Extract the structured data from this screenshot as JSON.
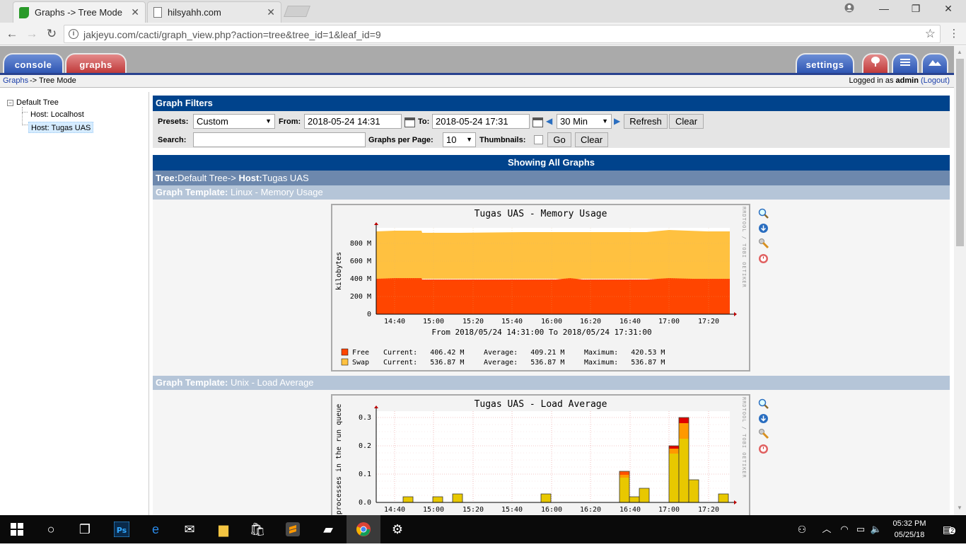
{
  "browser": {
    "tabs": [
      {
        "title": "Graphs -> Tree Mode",
        "active": true,
        "favicon": "cacti-icon"
      },
      {
        "title": "hilsyahh.com",
        "active": false,
        "favicon": "page-icon"
      }
    ],
    "close_glyph": "✕",
    "url": "jakjeyu.com/cacti/graph_view.php?action=tree&tree_id=1&leaf_id=9"
  },
  "cacti": {
    "tabs": {
      "console": "console",
      "graphs": "graphs",
      "settings": "settings"
    },
    "breadcrumb": {
      "root": "Graphs",
      "separator": "->",
      "current": "Tree Mode"
    },
    "login": {
      "prefix": "Logged in as",
      "user": "admin",
      "logout": "(Logout)"
    }
  },
  "tree": {
    "root": "Default Tree",
    "nodes": [
      "Host: Localhost",
      "Host: Tugas UAS"
    ],
    "selected_index": 1
  },
  "filters": {
    "header": "Graph Filters",
    "presets_label": "Presets:",
    "presets_value": "Custom",
    "from_label": "From:",
    "from_value": "2018-05-24 14:31",
    "to_label": "To:",
    "to_value": "2018-05-24 17:31",
    "timespan_value": "30 Min",
    "refresh_label": "Refresh",
    "clear_label": "Clear",
    "search_label": "Search:",
    "search_value": "",
    "per_page_label": "Graphs per Page:",
    "per_page_value": "10",
    "thumbnails_label": "Thumbnails:",
    "go_label": "Go",
    "clear2_label": "Clear"
  },
  "results": {
    "showing": "Showing All Graphs",
    "tree_label": "Tree:",
    "tree_value": "Default Tree->",
    "host_label": "Host:",
    "host_value": "Tugas UAS"
  },
  "graphs": [
    {
      "template_label": "Graph Template:",
      "template_name": "Linux - Memory Usage",
      "title": "Tugas UAS - Memory Usage",
      "side_text": "RRDTOOL / TOBI OETIKER",
      "ylabel": "kilobytes",
      "y_ticks": [
        "0",
        "200 M",
        "400 M",
        "600 M",
        "800 M"
      ],
      "x_ticks": [
        "14:40",
        "15:00",
        "15:20",
        "15:40",
        "16:00",
        "16:20",
        "16:40",
        "17:00",
        "17:20"
      ],
      "period": "From 2018/05/24 14:31:00 To 2018/05/24 17:31:00",
      "legend": [
        {
          "name": "Free",
          "color": "#ff4500",
          "current": "Current:   406.42 M",
          "average": "Average:   409.21 M",
          "maximum": "Maximum:   420.53 M"
        },
        {
          "name": "Swap",
          "color": "#ffc140",
          "current": "Current:   536.87 M",
          "average": "Average:   536.87 M",
          "maximum": "Maximum:   536.87 M"
        }
      ]
    },
    {
      "template_label": "Graph Template:",
      "template_name": "Unix - Load Average",
      "title": "Tugas UAS - Load Average",
      "side_text": "RRDTOOL / TOBI OETIKER",
      "ylabel": "processes in the run queue",
      "y_ticks": [
        "0.0",
        "0.1",
        "0.2",
        "0.3"
      ],
      "x_ticks": [
        "14:40",
        "15:00",
        "15:20",
        "15:40",
        "16:00",
        "16:20",
        "16:40",
        "17:00",
        "17:20"
      ]
    }
  ],
  "taskbar": {
    "time": "05:32 PM",
    "date": "05/25/18",
    "notifications": "2"
  }
}
